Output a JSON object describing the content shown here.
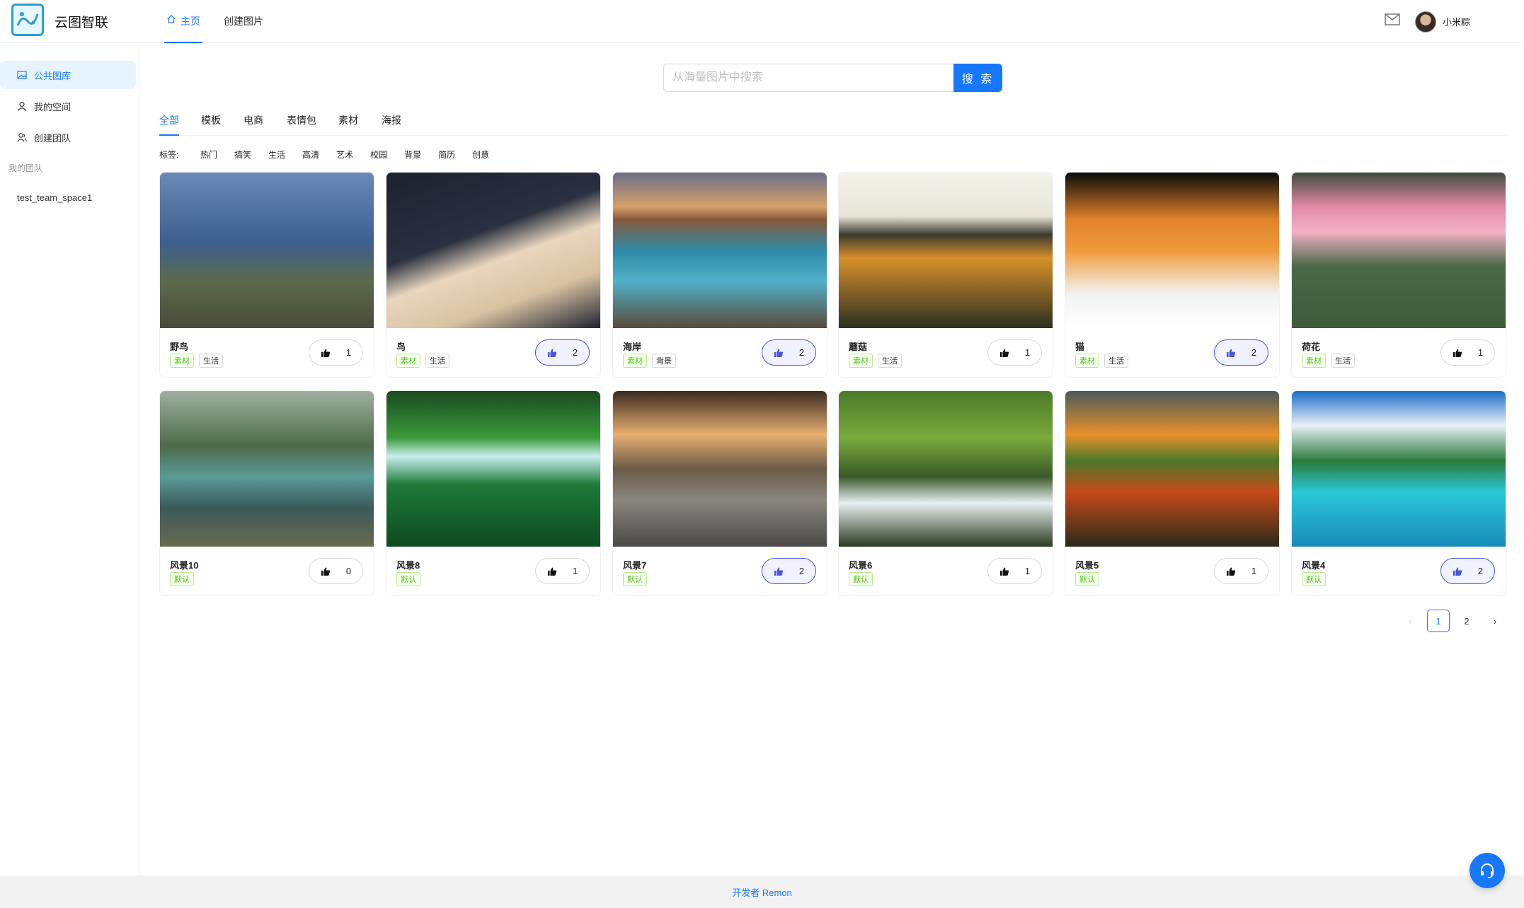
{
  "app": {
    "title": "云图智联"
  },
  "nav": {
    "home": "主页",
    "create": "创建图片"
  },
  "user": {
    "name": "小米粽"
  },
  "sidebar": {
    "items": [
      {
        "label": "公共图库",
        "icon": "picture-icon"
      },
      {
        "label": "我的空间",
        "icon": "user-icon"
      },
      {
        "label": "创建团队",
        "icon": "team-icon"
      }
    ],
    "group_label": "我的团队",
    "team": "test_team_space1"
  },
  "search": {
    "placeholder": "从海量图片中搜索",
    "button": "搜 索"
  },
  "categories": [
    "全部",
    "模板",
    "电商",
    "表情包",
    "素材",
    "海报"
  ],
  "tags": {
    "label": "标签:",
    "items": [
      "热门",
      "搞笑",
      "生活",
      "高清",
      "艺术",
      "校园",
      "背景",
      "简历",
      "创意"
    ]
  },
  "cards": [
    {
      "title": "野鸟",
      "tags": [
        "素材",
        "生活"
      ],
      "likes": "1",
      "liked": false
    },
    {
      "title": "鸟",
      "tags": [
        "素材",
        "生活"
      ],
      "likes": "2",
      "liked": true
    },
    {
      "title": "海岸",
      "tags": [
        "素材",
        "背景"
      ],
      "likes": "2",
      "liked": true
    },
    {
      "title": "蘑菇",
      "tags": [
        "素材",
        "生活"
      ],
      "likes": "1",
      "liked": false
    },
    {
      "title": "猫",
      "tags": [
        "素材",
        "生活"
      ],
      "likes": "2",
      "liked": true
    },
    {
      "title": "荷花",
      "tags": [
        "素材",
        "生活"
      ],
      "likes": "1",
      "liked": false
    },
    {
      "title": "风景10",
      "tags": [
        "默认"
      ],
      "likes": "0",
      "liked": false
    },
    {
      "title": "风景8",
      "tags": [
        "默认"
      ],
      "likes": "1",
      "liked": false
    },
    {
      "title": "风景7",
      "tags": [
        "默认"
      ],
      "likes": "2",
      "liked": true
    },
    {
      "title": "风景6",
      "tags": [
        "默认"
      ],
      "likes": "1",
      "liked": false
    },
    {
      "title": "风景5",
      "tags": [
        "默认"
      ],
      "likes": "1",
      "liked": false
    },
    {
      "title": "风景4",
      "tags": [
        "默认"
      ],
      "likes": "2",
      "liked": true
    }
  ],
  "pagination": {
    "prev": "‹",
    "pages": [
      "1",
      "2"
    ],
    "current": "1",
    "next": "›"
  },
  "footer": {
    "text": "开发者 Remon"
  },
  "colors": {
    "primary": "#1677ff",
    "liked_border": "#4a55d8",
    "tag_green": "#52c41a"
  }
}
